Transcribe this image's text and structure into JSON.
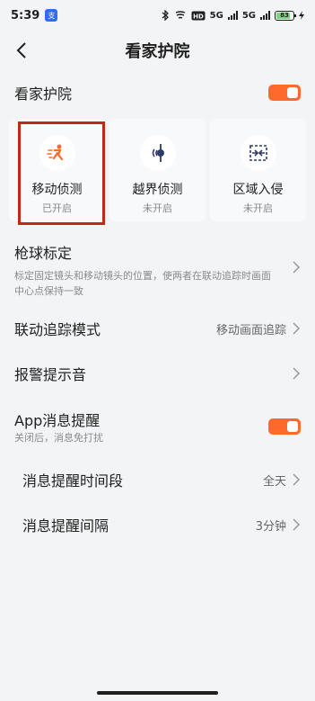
{
  "status": {
    "time": "5:39",
    "app_badge": "支",
    "net1": "5G",
    "net2": "5G",
    "battery": "83"
  },
  "nav": {
    "title": "看家护院"
  },
  "main_toggle": {
    "label": "看家护院",
    "on": true
  },
  "modes": [
    {
      "label": "移动侦测",
      "status": "已开启",
      "icon": "motion-detection-icon"
    },
    {
      "label": "越界侦测",
      "status": "未开启",
      "icon": "line-crossing-icon"
    },
    {
      "label": "区域入侵",
      "status": "未开启",
      "icon": "area-intrusion-icon"
    }
  ],
  "calibration": {
    "title": "枪球标定",
    "desc": "标定固定镜头和移动镜头的位置，使两者在联动追踪时画面中心点保持一致"
  },
  "tracking": {
    "title": "联动追踪模式",
    "value": "移动画面追踪"
  },
  "alarm": {
    "title": "报警提示音"
  },
  "app_notify": {
    "title": "App消息提醒",
    "desc": "关闭后，消息免打扰",
    "on": true
  },
  "notify_period": {
    "title": "消息提醒时间段",
    "value": "全天"
  },
  "notify_interval": {
    "title": "消息提醒间隔",
    "value": "3分钟"
  },
  "colors": {
    "accent": "#ff6a2c",
    "highlight": "#c0281e"
  }
}
